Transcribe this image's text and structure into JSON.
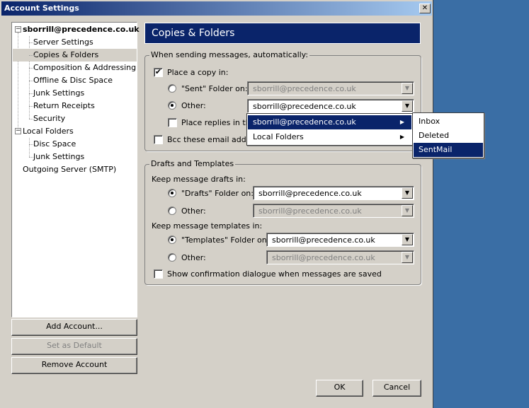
{
  "window": {
    "title": "Account Settings",
    "close_glyph": "✕"
  },
  "tree": {
    "account": "sborrill@precedence.co.uk",
    "account_items": [
      "Server Settings",
      "Copies & Folders",
      "Composition & Addressing",
      "Offline & Disc Space",
      "Junk Settings",
      "Return Receipts",
      "Security"
    ],
    "local": "Local Folders",
    "local_items": [
      "Disc Space",
      "Junk Settings"
    ],
    "outgoing": "Outgoing Server (SMTP)",
    "selected": "Copies & Folders"
  },
  "buttons": {
    "add_account": "Add Account...",
    "set_default": "Set as Default",
    "remove_account": "Remove Account",
    "ok": "OK",
    "cancel": "Cancel"
  },
  "panel": {
    "title": "Copies & Folders",
    "sending": {
      "legend": "When sending messages, automatically:",
      "place_copy": "Place a copy in:",
      "sent_folder": "\"Sent\" Folder on:",
      "sent_value": "sborrill@precedence.co.uk",
      "other": "Other:",
      "other_value": "sborrill@precedence.co.uk",
      "place_replies": "Place replies in the",
      "bcc": "Bcc these email addres"
    },
    "drafts": {
      "legend": "Drafts and Templates",
      "keep_drafts": "Keep message drafts in:",
      "drafts_folder": "\"Drafts\" Folder on:",
      "drafts_value": "sborrill@precedence.co.uk",
      "other": "Other:",
      "other_value": "sborrill@precedence.co.uk",
      "keep_templates": "Keep message templates in:",
      "templates_folder": "\"Templates\" Folder on:",
      "templates_value": "sborrill@precedence.co.uk",
      "other2": "Other:",
      "other2_value": "sborrill@precedence.co.uk",
      "show_confirm": "Show confirmation dialogue when messages are saved"
    }
  },
  "popup": {
    "items": [
      "sborrill@precedence.co.uk",
      "Local Folders"
    ],
    "submenu": [
      "Inbox",
      "Deleted",
      "SentMail"
    ]
  },
  "colors": {
    "accent": "#0a246a",
    "face": "#d4d0c8",
    "desktop": "#3a6ea5"
  }
}
